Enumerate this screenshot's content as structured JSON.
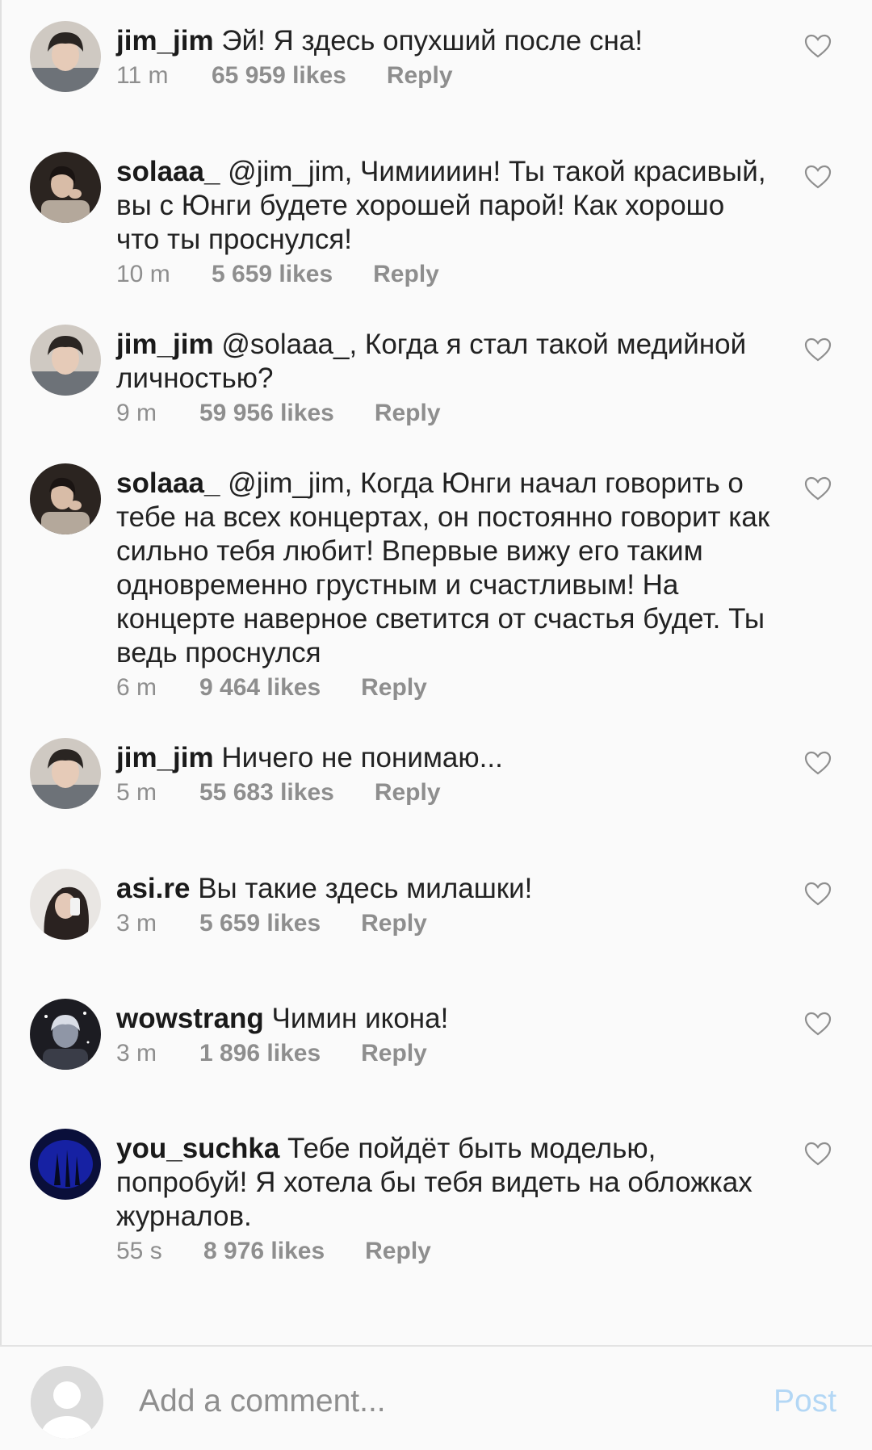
{
  "colors": {
    "background": "#fafafa",
    "text": "#222222",
    "meta": "#8e8e8e",
    "post_disabled": "#b3d7f5"
  },
  "comments": [
    {
      "username": "jim_jim",
      "text": "Эй! Я здесь опухший после сна!",
      "time": "11 m",
      "likes": "65 959 likes",
      "reply": "Reply",
      "avatar_icon": "avatar-jim-jim"
    },
    {
      "username": "solaaa_",
      "text": "@jim_jim, Чимиииин! Ты такой красивый, вы с Юнги будете хорошей парой! Как хорошо что ты проснулся!",
      "time": "10 m",
      "likes": "5 659 likes",
      "reply": "Reply",
      "avatar_icon": "avatar-solaaa"
    },
    {
      "username": "jim_jim",
      "text": "@solaaa_, Когда я стал такой медийной личностью?",
      "time": "9 m",
      "likes": "59 956 likes",
      "reply": "Reply",
      "avatar_icon": "avatar-jim-jim"
    },
    {
      "username": "solaaa_",
      "text": "@jim_jim, Когда Юнги начал говорить о тебе на всех концертах, он постоянно говорит как сильно тебя любит! Впервые вижу его таким одновременно грустным и счастливым! На концерте наверное светится от счастья будет. Ты ведь проснулся",
      "time": "6 m",
      "likes": "9 464 likes",
      "reply": "Reply",
      "avatar_icon": "avatar-solaaa"
    },
    {
      "username": "jim_jim",
      "text": "Ничего не понимаю...",
      "time": "5 m",
      "likes": "55 683 likes",
      "reply": "Reply",
      "avatar_icon": "avatar-jim-jim"
    },
    {
      "username": "asi.re",
      "text": "Вы такие здесь милашки!",
      "time": "3 m",
      "likes": "5 659 likes",
      "reply": "Reply",
      "avatar_icon": "avatar-asi-re"
    },
    {
      "username": "wowstrang",
      "text": "Чимин икона!",
      "time": "3 m",
      "likes": "1 896 likes",
      "reply": "Reply",
      "avatar_icon": "avatar-wowstrang"
    },
    {
      "username": "you_suchka",
      "text": "Тебе пойдёт быть моделью, попробуй! Я хотела бы тебя видеть на обложках журналов.",
      "time": "55 s",
      "likes": "8 976 likes",
      "reply": "Reply",
      "avatar_icon": "avatar-you-suchka"
    }
  ],
  "composer": {
    "placeholder": "Add a comment...",
    "value": "",
    "post_label": "Post"
  }
}
